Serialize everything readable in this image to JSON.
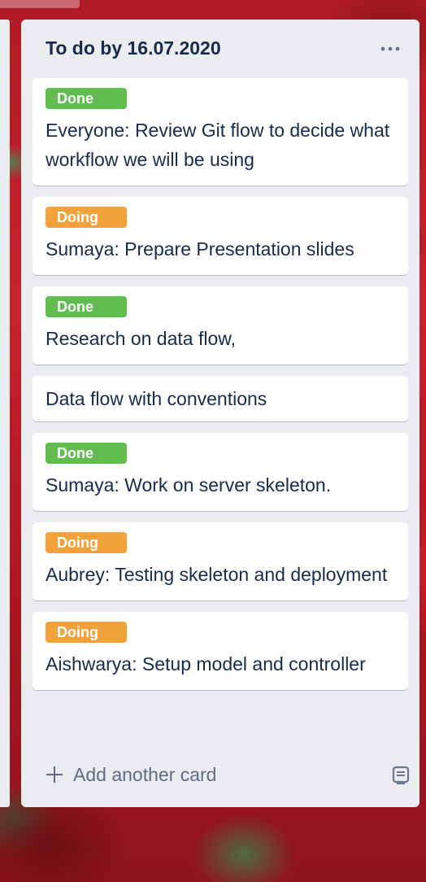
{
  "list": {
    "title": "To do by 16.07.2020",
    "menu_icon": "more-horizontal-icon",
    "cards": [
      {
        "label": "Done",
        "label_color": "#61bd4f",
        "title": "Everyone: Review Git flow to decide what workflow we will be using"
      },
      {
        "label": "Doing",
        "label_color": "#f2a23a",
        "title": "Sumaya: Prepare Presentation slides"
      },
      {
        "label": "Done",
        "label_color": "#61bd4f",
        "title": "Research on data flow,"
      },
      {
        "label": null,
        "title": "Data flow with conventions"
      },
      {
        "label": "Done",
        "label_color": "#61bd4f",
        "title": "Sumaya: Work on server skeleton."
      },
      {
        "label": "Doing",
        "label_color": "#f2a23a",
        "title": "Aubrey: Testing skeleton and deployment"
      },
      {
        "label": "Doing",
        "label_color": "#f2a23a",
        "title": "Aishwarya: Setup model and controller"
      }
    ],
    "add_card_label": "Add another card",
    "add_icon": "plus-icon",
    "template_icon": "card-template-icon"
  }
}
